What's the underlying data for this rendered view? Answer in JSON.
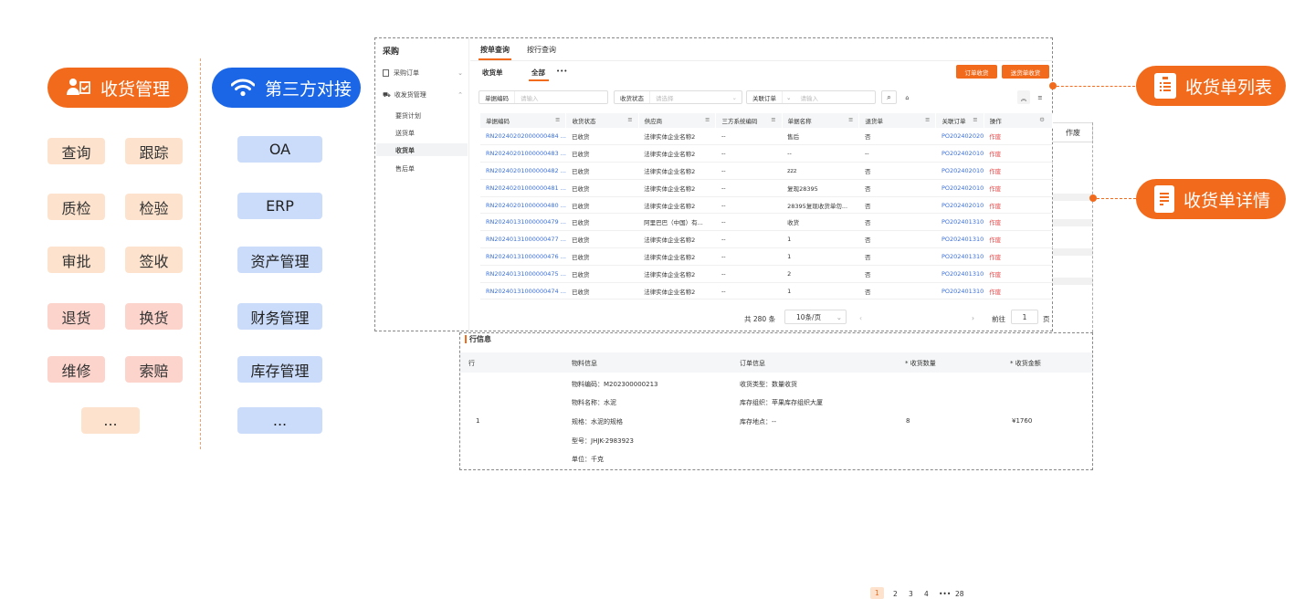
{
  "left_cards": {
    "receiving": {
      "title": "收货管理",
      "icon": "user-check-icon",
      "color": "#f26b1d"
    },
    "third_party": {
      "title": "第三方对接",
      "icon": "wifi-icon",
      "color": "#1a66e6"
    },
    "ops": [
      [
        "查询",
        "跟踪"
      ],
      [
        "质检",
        "检验"
      ],
      [
        "审批",
        "签收"
      ],
      [
        "退货",
        "换货"
      ],
      [
        "维修",
        "索赔"
      ],
      [
        "..."
      ]
    ],
    "systems": [
      "OA",
      "ERP",
      "资产管理",
      "财务管理",
      "库存管理",
      "..."
    ]
  },
  "callouts": {
    "list": "收货单列表",
    "detail": "收货单详情"
  },
  "app": {
    "module": "采购",
    "nav": [
      {
        "label": "采购订单",
        "icon": "list-icon"
      },
      {
        "label": "收发货管理",
        "icon": "truck-icon",
        "children": [
          "要货计划",
          "送货单",
          "收货单",
          "售后单"
        ]
      }
    ],
    "tabs": [
      "按单查询",
      "按行查询"
    ],
    "subtabs": {
      "title": "收货单",
      "all": "全部",
      "more": "•••"
    },
    "buttons": {
      "order_receive": "订单收货",
      "delivery_receive": "送货单收货"
    },
    "filters": [
      {
        "label": "单据编码",
        "placeholder": "请输入"
      },
      {
        "label": "收货状态",
        "placeholder": "请选择"
      },
      {
        "label": "关联订单",
        "placeholder": "请输入"
      }
    ],
    "columns": [
      "单据编码",
      "收货状态",
      "供应商",
      "三方系统编码",
      "单据名称",
      "退货单",
      "关联订单",
      "操作"
    ],
    "rows": [
      [
        "RN20240202000000484 ...",
        "已收货",
        "法律实体企业名称2",
        "--",
        "售后",
        "否",
        "PO202402020",
        "作废"
      ],
      [
        "RN20240201000000483 ...",
        "已收货",
        "法律实体企业名称2",
        "--",
        "--",
        "--",
        "PO202402010",
        "作废"
      ],
      [
        "RN20240201000000482 ...",
        "已收货",
        "法律实体企业名称2",
        "--",
        "zzz",
        "否",
        "PO202402010",
        "作废"
      ],
      [
        "RN20240201000000481 ...",
        "已收货",
        "法律实体企业名称2",
        "--",
        "复现28395",
        "否",
        "PO202402010",
        "作废"
      ],
      [
        "RN20240201000000480 ...",
        "已收货",
        "法律实体企业名称2",
        "--",
        "28395复现收货单勿...",
        "否",
        "PO202402010",
        "作废"
      ],
      [
        "RN20240131000000479 ...",
        "已收货",
        "阿里巴巴（中国）有...",
        "--",
        "收货",
        "否",
        "PO202401310",
        "作废"
      ],
      [
        "RN20240131000000477 ...",
        "已收货",
        "法律实体企业名称2",
        "--",
        "1",
        "否",
        "PO202401310",
        "作废"
      ],
      [
        "RN20240131000000476 ...",
        "已收货",
        "法律实体企业名称2",
        "--",
        "1",
        "否",
        "PO202401310",
        "作废"
      ],
      [
        "RN20240131000000475 ...",
        "已收货",
        "法律实体企业名称2",
        "--",
        "2",
        "否",
        "PO202401310",
        "作废"
      ],
      [
        "RN20240131000000474 ...",
        "已收货",
        "法律实体企业名称2",
        "--",
        "1",
        "否",
        "PO202401310",
        "作废"
      ]
    ],
    "pager": {
      "total": "共 280 条",
      "size": "10条/页",
      "pages": [
        "1",
        "2",
        "3",
        "4",
        "•••",
        "28"
      ],
      "goto": "前往",
      "goto_val": "1",
      "page_unit": "页"
    },
    "behind_action": "作废"
  },
  "detail": {
    "title": "行信息",
    "columns": [
      "行",
      "物料信息",
      "订单信息",
      "* 收货数量",
      "* 收货金额"
    ],
    "row": {
      "line": "1",
      "material": [
        "物料编码：M202300000213",
        "物料名称：水泥",
        "规格：水泥的规格",
        "型号：JHJK-2983923",
        "单位：千克"
      ],
      "order": [
        "收货类型：数量收货",
        "库存组织：苹果库存组织大厦",
        "库存地点：--"
      ],
      "qty": "8",
      "amount": "¥1760"
    }
  }
}
